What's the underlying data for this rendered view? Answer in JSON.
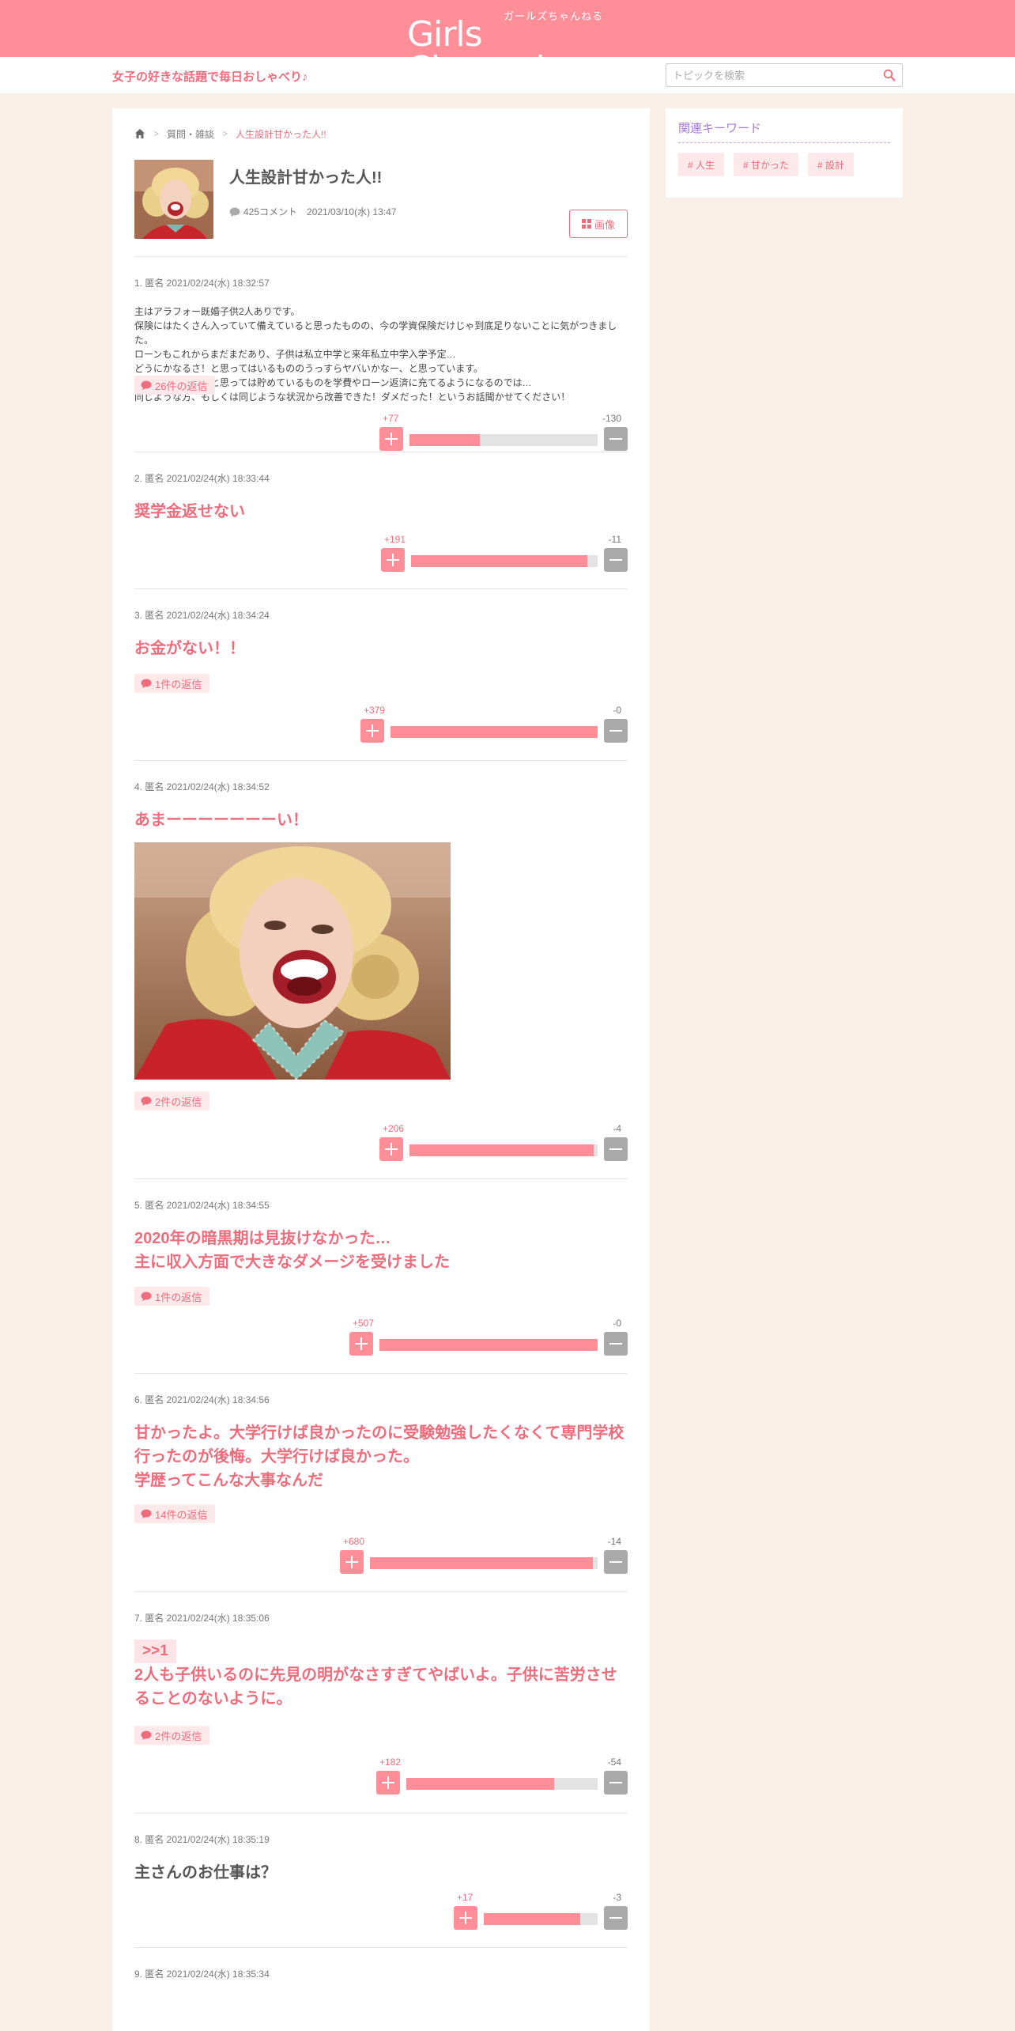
{
  "header": {
    "logo_main": "Girls Channel",
    "logo_kana": "ガールズちゃんねる",
    "tagline": "女子の好きな話題で毎日おしゃべり♪",
    "search_placeholder": "トピックを検索"
  },
  "breadcrumb": [
    "質問・雑談",
    "人生設計甘かった人!!"
  ],
  "topic": {
    "title": "人生設計甘かった人!!",
    "comment_count": "425コメント",
    "date": "2021/03/10(水) 13:47",
    "image_button": "画像"
  },
  "sidebar": {
    "title": "関連キーワード",
    "tags": [
      "# 人生",
      "# 甘かった",
      "# 設計"
    ]
  },
  "comments": [
    {
      "head": "1. 匿名 2021/02/24(水) 18:32:57",
      "body_lines": [
        "主はアラフォー既婚子供2人ありです。",
        "保険にはたくさん入っていて備えていると思ったものの、今の学資保険だけじゃ到底足りないことに気がつきました。",
        "ローンもこれからまだまだあり、子供は私立中学と来年私立中学入学予定…",
        "どうにかなるさ！と思ってはいるもののうっすらヤバいかなー、と思っています。",
        "おそらく老後資金と思っては貯めているものを学費やローン返済に充てるようになるのでは…",
        "同じような方、もしくは同じような状況から改善できた！ダメだった！というお話聞かせてください！"
      ],
      "reply": "26件の返信",
      "plus": 77,
      "minus": 130,
      "plus_label": "+77",
      "minus_label": "-130"
    },
    {
      "head": "2. 匿名 2021/02/24(水) 18:33:44",
      "body": "奨学金返せない",
      "plus": 191,
      "minus": 11,
      "plus_label": "+191",
      "minus_label": "-11"
    },
    {
      "head": "3. 匿名 2021/02/24(水) 18:34:24",
      "body": "お金がない！！",
      "reply": "1件の返信",
      "plus": 379,
      "minus": 0,
      "plus_label": "+379",
      "minus_label": "-0"
    },
    {
      "head": "4. 匿名 2021/02/24(水) 18:34:52",
      "body": "あまーーーーーーーい！",
      "reply": "2件の返信",
      "plus": 206,
      "minus": 4,
      "plus_label": "+206",
      "minus_label": "-4"
    },
    {
      "head": "5. 匿名 2021/02/24(水) 18:34:55",
      "body_lines": [
        "2020年の暗黒期は見抜けなかった…",
        "主に収入方面で大きなダメージを受けました"
      ],
      "reply": "1件の返信",
      "plus": 507,
      "minus": 0,
      "plus_label": "+507",
      "minus_label": "-0"
    },
    {
      "head": "6. 匿名 2021/02/24(水) 18:34:56",
      "body_lines": [
        "甘かったよ。大学行けば良かったのに受験勉強したくなくて専門学校",
        "行ったのが後悔。大学行けば良かった。",
        "学歴ってこんな大事なんだ"
      ],
      "reply": "14件の返信",
      "plus": 680,
      "minus": 14,
      "plus_label": "+680",
      "minus_label": "-14"
    },
    {
      "head": "7. 匿名 2021/02/24(水) 18:35:06",
      "anchor": ">>1",
      "body_lines": [
        "2人も子供いるのに先見の明がなさすぎてやばいよ。子供に苦労させ",
        "ることのないように。"
      ],
      "reply": "2件の返信",
      "plus": 182,
      "minus": 54,
      "plus_label": "+182",
      "minus_label": "-54"
    },
    {
      "head": "8. 匿名 2021/02/24(水) 18:35:19",
      "body": "主さんのお仕事は？",
      "plus": 17,
      "minus": 3,
      "plus_label": "+17",
      "minus_label": "-3"
    },
    {
      "head": "9. 匿名 2021/02/24(水) 18:35:34"
    }
  ],
  "colors": {
    "brand": "#ff8e99",
    "accent_text": "#ef6c7c",
    "background": "#f8f0e6",
    "keyword_title": "#a87bdc"
  }
}
